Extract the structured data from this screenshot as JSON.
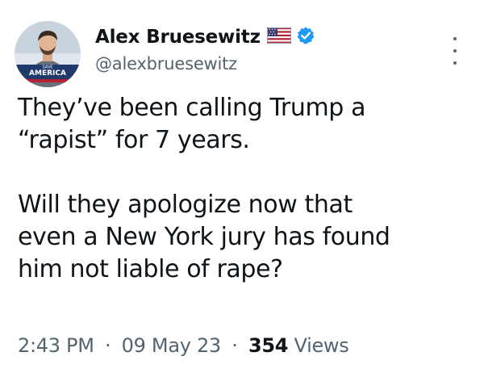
{
  "author": {
    "display_name": "Alex Bruesewitz",
    "handle": "@alexbruesewitz",
    "avatar_badge_line1": "SAVE",
    "avatar_badge_line2": "AMERICA",
    "flag_icon": "us-flag-icon",
    "verified_icon": "verified-badge-icon",
    "verified_color": "#1d9bf0"
  },
  "tweet": {
    "line1": "They’ve been calling Trump a",
    "line2": "“rapist” for 7 years.",
    "line3": "Will they apologize now that",
    "line4": "even a New York jury has found",
    "line5": "him not liable of rape?"
  },
  "meta": {
    "time": "2:43 PM",
    "date": "09 May 23",
    "view_count": "354",
    "views_label": "Views",
    "separator": "·"
  },
  "colors": {
    "text": "#0f1419",
    "secondary": "#536471",
    "background": "#ffffff"
  }
}
